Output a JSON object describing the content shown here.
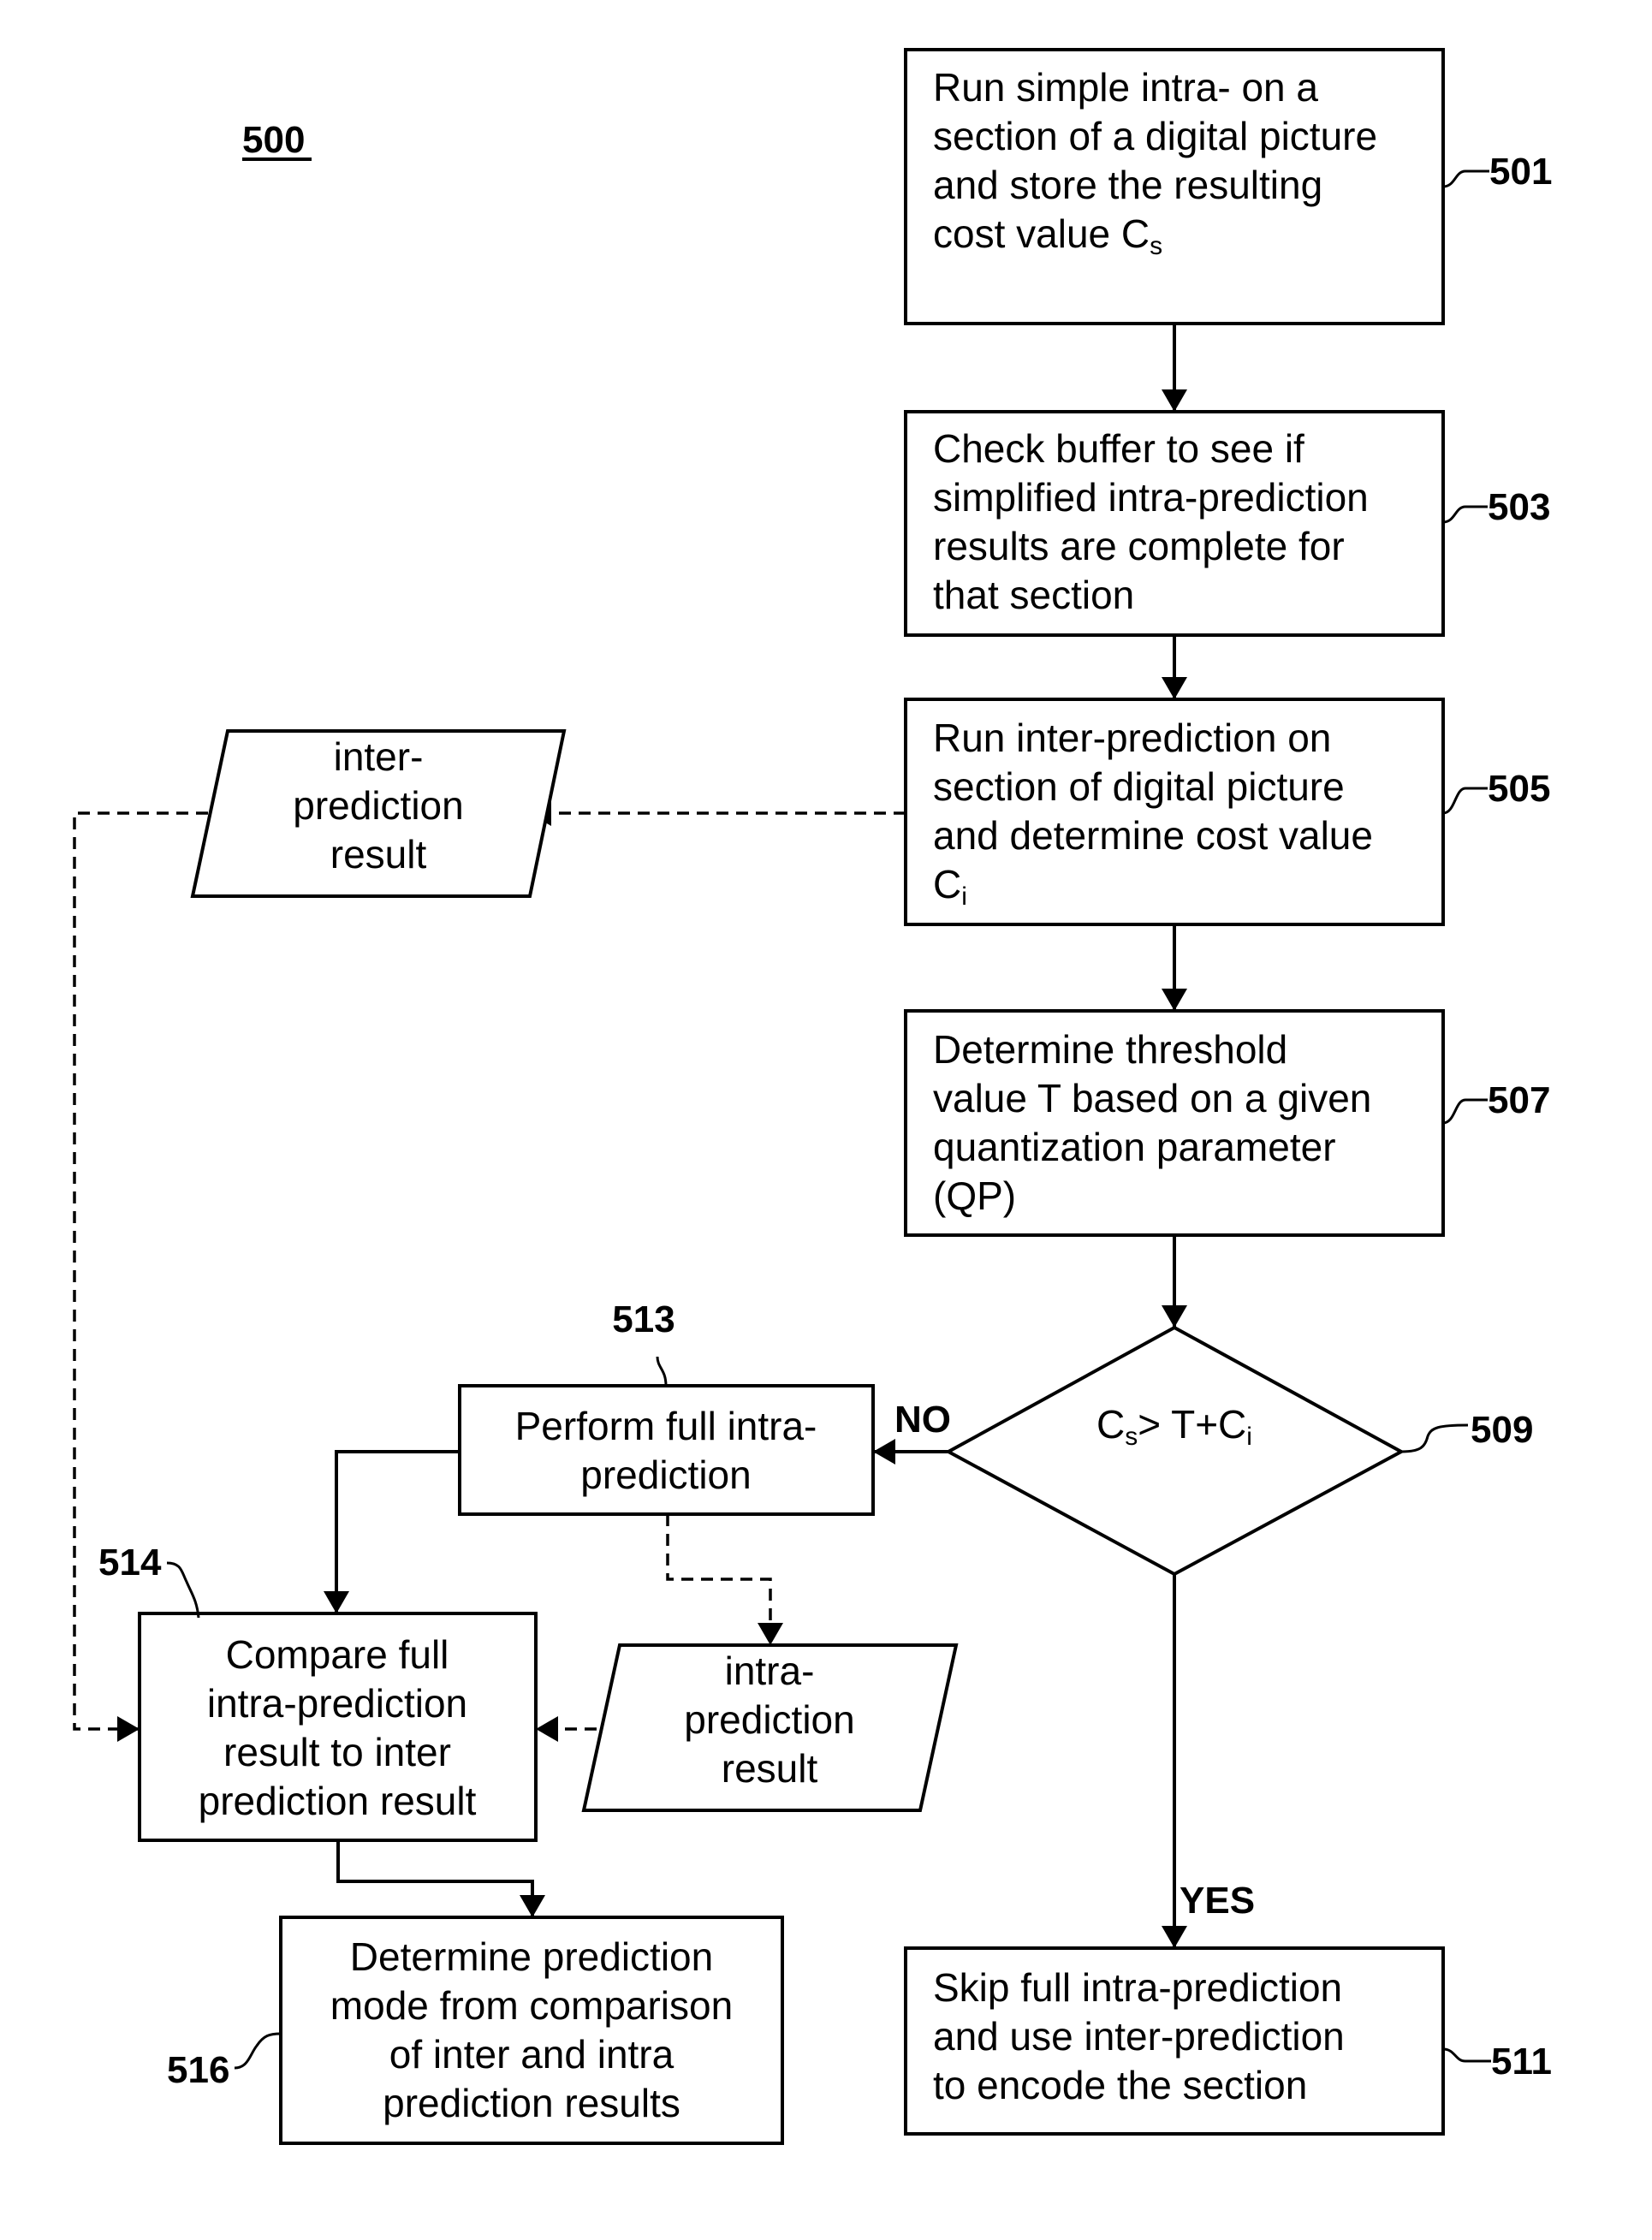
{
  "figure": {
    "label": "500"
  },
  "steps": {
    "s501": {
      "ref": "501",
      "lines": [
        "Run simple intra- on a",
        "section of a digital picture",
        "and store the resulting",
        "cost value C"
      ],
      "subscript": "s"
    },
    "s503": {
      "ref": "503",
      "lines": [
        "Check buffer to see if",
        "simplified intra-prediction",
        "results are complete for",
        "that section"
      ]
    },
    "s505": {
      "ref": "505",
      "lines": [
        "Run inter-prediction on",
        "section of digital picture",
        "and determine cost value",
        "C"
      ],
      "subscript": "i"
    },
    "s507": {
      "ref": "507",
      "lines": [
        "Determine threshold",
        "value T based on a given",
        "quantization parameter",
        "(QP)"
      ]
    },
    "s509": {
      "ref": "509",
      "condition_parts": [
        "C",
        "s",
        "> T+C",
        "i"
      ]
    },
    "s511": {
      "ref": "511",
      "lines": [
        "Skip full intra-prediction",
        "and use inter-prediction",
        "to encode the section"
      ]
    },
    "s513": {
      "ref": "513",
      "lines": [
        "Perform full intra-",
        "prediction"
      ]
    },
    "s514": {
      "ref": "514",
      "lines": [
        "Compare full",
        "intra-prediction",
        "result to inter",
        "prediction result"
      ]
    },
    "s516": {
      "ref": "516",
      "lines": [
        "Determine prediction",
        "mode from comparison",
        "of  inter and intra",
        "prediction results"
      ]
    }
  },
  "data_nodes": {
    "inter_result": {
      "lines": [
        "inter-",
        "prediction",
        "result"
      ]
    },
    "intra_result": {
      "lines": [
        "intra-",
        "prediction",
        "result"
      ]
    }
  },
  "branch_labels": {
    "no": "NO",
    "yes": "YES"
  }
}
